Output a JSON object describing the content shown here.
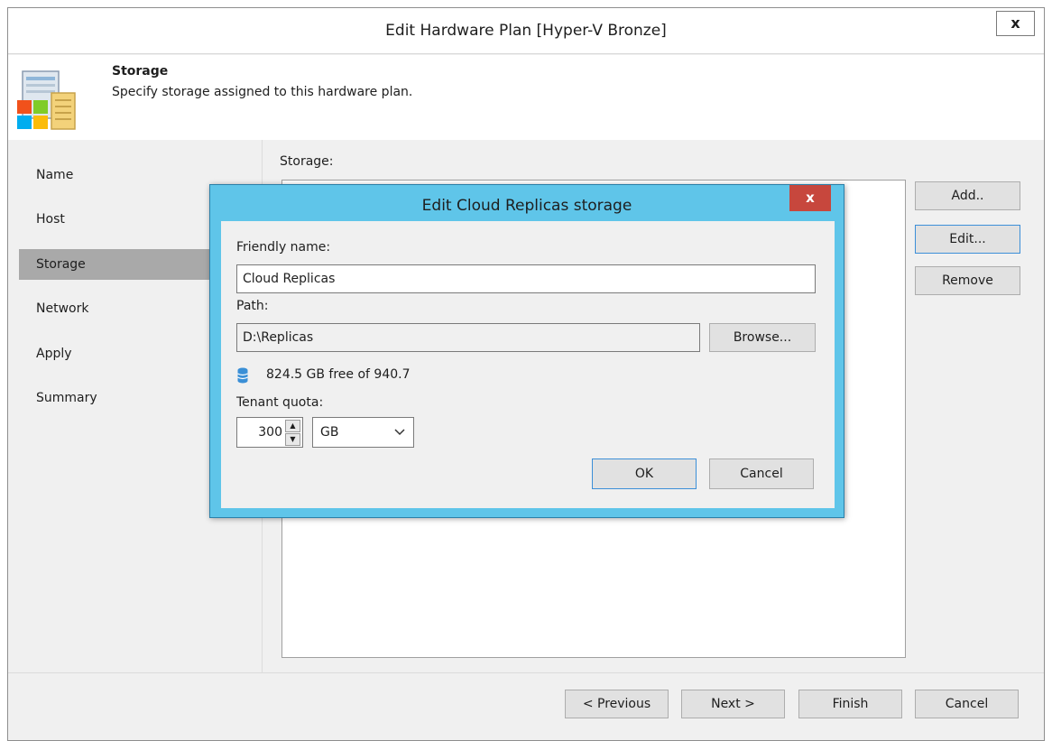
{
  "window": {
    "title": "Edit Hardware Plan [Hyper-V Bronze]",
    "close_label": "x"
  },
  "header": {
    "title": "Storage",
    "subtitle": "Specify storage assigned to this hardware plan."
  },
  "nav": {
    "items": [
      "Name",
      "Host",
      "Storage",
      "Network",
      "Apply",
      "Summary"
    ],
    "active_index": 2
  },
  "content": {
    "storage_label": "Storage:"
  },
  "side_buttons": {
    "add": "Add..",
    "edit": "Edit...",
    "remove": "Remove"
  },
  "footer": {
    "previous": "< Previous",
    "next": "Next >",
    "finish": "Finish",
    "cancel": "Cancel"
  },
  "dialog": {
    "title": "Edit Cloud Replicas storage",
    "close_label": "x",
    "friendly_name_label": "Friendly name:",
    "friendly_name_value": "Cloud Replicas",
    "path_label": "Path:",
    "path_value": "D:\\Replicas",
    "browse": "Browse...",
    "free_space": "824.5 GB free of 940.7",
    "tenant_quota_label": "Tenant quota:",
    "quota_value": "300",
    "quota_unit": "GB",
    "ok": "OK",
    "cancel": "Cancel"
  },
  "colors": {
    "dialog_frame": "#5fc5e9",
    "close_red": "#c7473d",
    "nav_active": "#a9a9a9",
    "focus_blue": "#3c8fd8"
  }
}
